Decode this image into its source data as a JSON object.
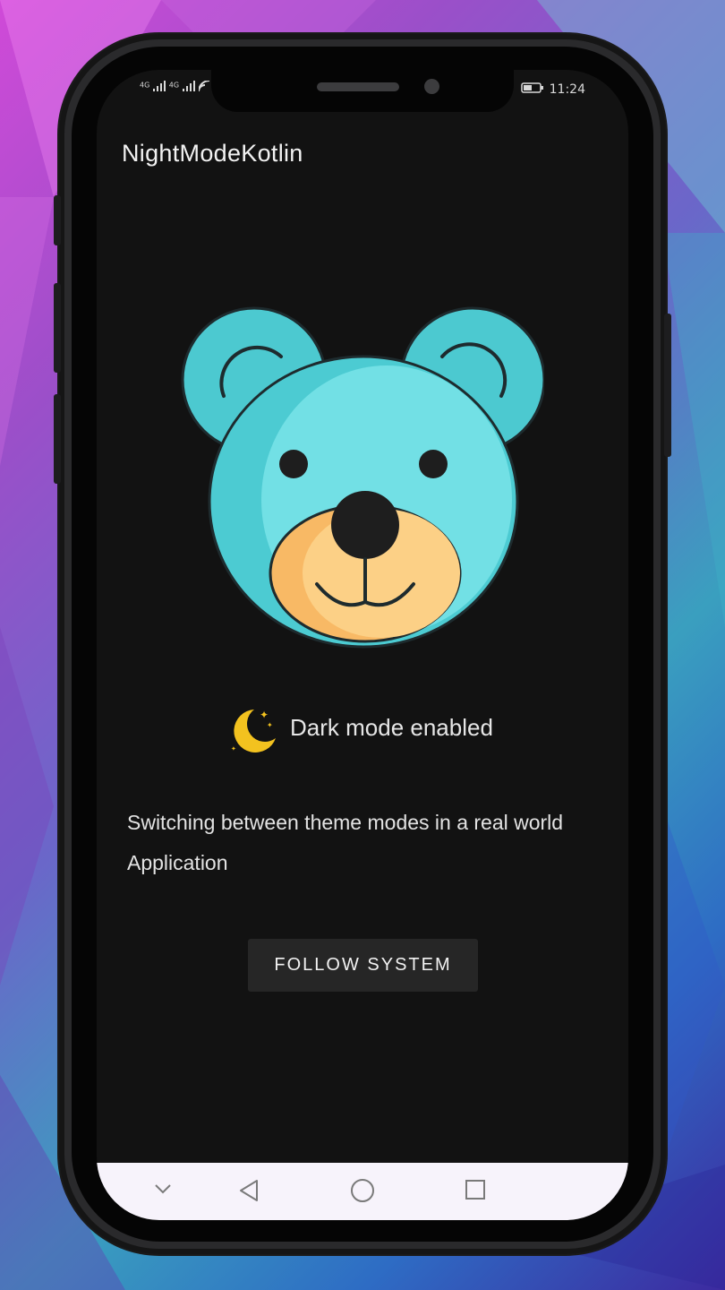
{
  "status_bar": {
    "network_left": "4G",
    "network_right": "4G",
    "time": "11:24"
  },
  "app": {
    "title": "NightModeKotlin"
  },
  "content": {
    "mode_icon": "crescent-moon-icon",
    "mode_text": "Dark mode enabled",
    "description": "Switching between theme modes in a real world Application",
    "button_label": "FOLLOW SYSTEM"
  },
  "nav_bar": {
    "icons": [
      "chevron-down-icon",
      "back-icon",
      "home-icon",
      "recents-icon"
    ]
  },
  "colors": {
    "screen_bg": "#121212",
    "bear_head": "#5ed6da",
    "bear_muzzle": "#fbc97a",
    "button_bg": "#262626",
    "navbar_bg": "#f7f3fb"
  }
}
